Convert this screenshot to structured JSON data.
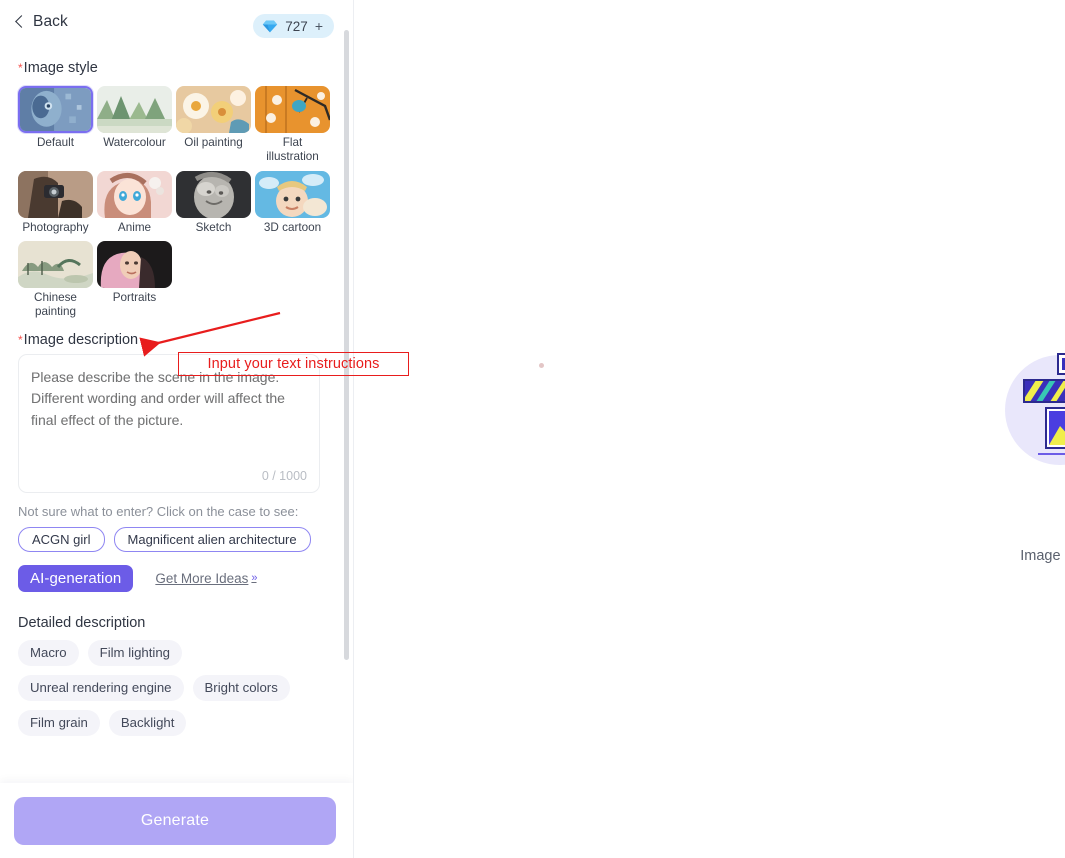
{
  "header": {
    "back_label": "Back",
    "credits_value": "727",
    "credits_plus": "+",
    "gem_icon": "gem-icon"
  },
  "style_section": {
    "required_mark": "*",
    "label": "Image style",
    "items": [
      {
        "label": "Default",
        "selected": true
      },
      {
        "label": "Watercolour",
        "selected": false
      },
      {
        "label": "Oil painting",
        "selected": false
      },
      {
        "label": "Flat illustration",
        "selected": false
      },
      {
        "label": "Photography",
        "selected": false
      },
      {
        "label": "Anime",
        "selected": false
      },
      {
        "label": "Sketch",
        "selected": false
      },
      {
        "label": "3D cartoon",
        "selected": false
      },
      {
        "label": "Chinese painting",
        "selected": false
      },
      {
        "label": "Portraits",
        "selected": false
      }
    ]
  },
  "description_section": {
    "required_mark": "*",
    "label": "Image description",
    "placeholder": "Please describe the scene in the image. Different wording and order will affect the final effect of the picture.",
    "value": "",
    "counter": "0 / 1000"
  },
  "cases_section": {
    "hint": "Not sure what to enter? Click on the case to see:",
    "chips": [
      "ACGN girl",
      "Magnificent alien architecture"
    ],
    "ai_button": "AI-generation",
    "more_ideas": "Get More Ideas",
    "more_ideas_arrows": "»"
  },
  "detail_section": {
    "title": "Detailed description",
    "tags": [
      "Macro",
      "Film lighting",
      "Unreal rendering engine",
      "Bright colors",
      "Film grain",
      "Backlight"
    ]
  },
  "footer": {
    "generate_label": "Generate"
  },
  "canvas": {
    "empty_caption": "Image genera"
  },
  "annotation": {
    "text": "Input your text instructions",
    "color": "#e81d1d"
  },
  "colors": {
    "accent": "#6c5ce7",
    "accent_disabled": "#b0a6f5",
    "credits_bg": "#ddf0fb",
    "required": "#f5544f",
    "tag_bg": "#f4f4f9"
  }
}
